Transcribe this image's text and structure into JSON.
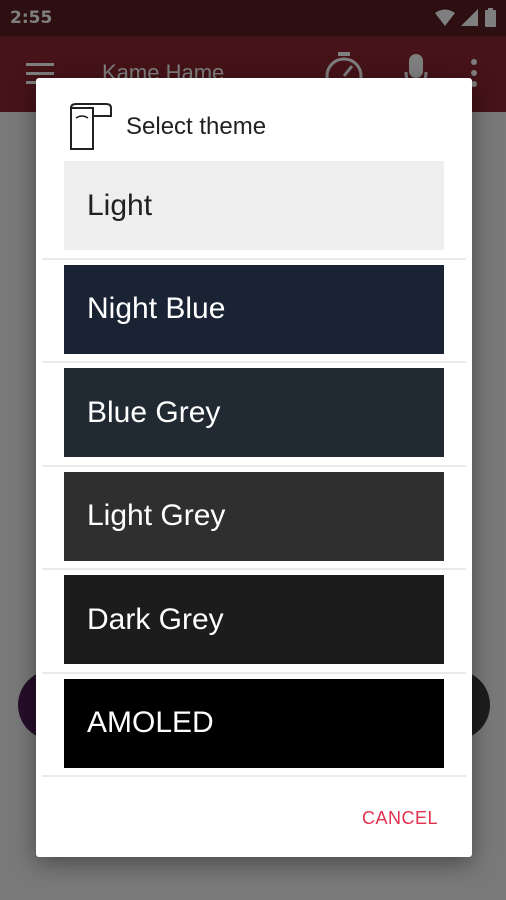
{
  "status_bar": {
    "time": "2:55"
  },
  "app_bar": {
    "title": "Kame Hame"
  },
  "dialog": {
    "title": "Select theme",
    "themes": [
      {
        "label": "Light",
        "bg": "#eeeeee",
        "fg": "#212121"
      },
      {
        "label": "Night Blue",
        "bg": "#1a2333",
        "fg": "#ffffff"
      },
      {
        "label": "Blue Grey",
        "bg": "#212a32",
        "fg": "#ffffff"
      },
      {
        "label": "Light Grey",
        "bg": "#2f2f2f",
        "fg": "#ffffff"
      },
      {
        "label": "Dark Grey",
        "bg": "#1c1c1c",
        "fg": "#ffffff"
      },
      {
        "label": "AMOLED",
        "bg": "#000000",
        "fg": "#ffffff"
      }
    ],
    "cancel_label": "CANCEL"
  },
  "colors": {
    "accent": "#e0314f",
    "app_bar": "#8b2630",
    "status_bar": "#5a1d22"
  }
}
